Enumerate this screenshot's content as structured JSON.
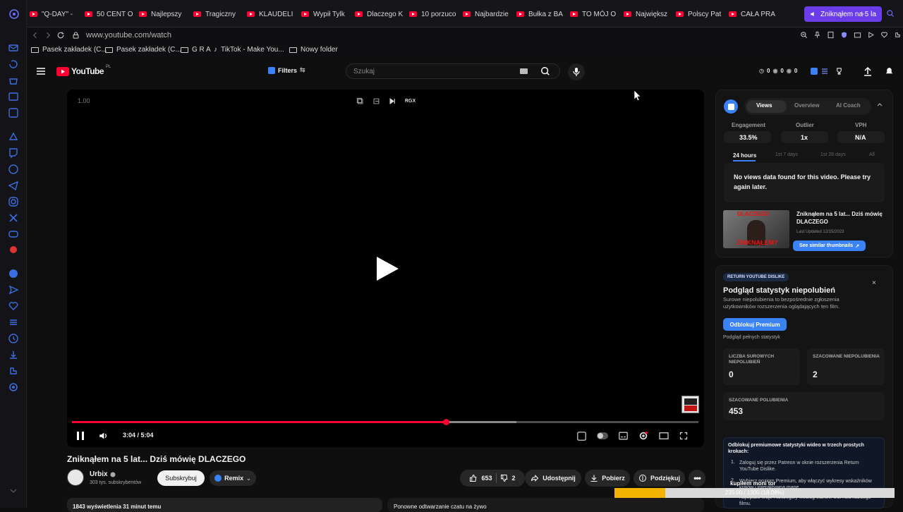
{
  "tabs": [
    {
      "label": "\"Q-DAY\" -"
    },
    {
      "label": "50 CENT O"
    },
    {
      "label": "Najlepszy"
    },
    {
      "label": "Tragiczny"
    },
    {
      "label": "KLAUDELI"
    },
    {
      "label": "Wypił Tylk"
    },
    {
      "label": "Dlaczego K"
    },
    {
      "label": "10 porzuco"
    },
    {
      "label": "Najbardzie"
    },
    {
      "label": "Bułka z BA"
    },
    {
      "label": "TO MÓJ O"
    },
    {
      "label": "Największ"
    },
    {
      "label": "Polscy Pat"
    },
    {
      "label": "CAŁA PRA"
    }
  ],
  "active_tab": {
    "label": "Zniknąłem na 5 la"
  },
  "url": "www.youtube.com/watch",
  "bookmarks": [
    {
      "label": "Pasek zakładek (C..."
    },
    {
      "label": "Pasek zakładek (C..."
    },
    {
      "label": "G R A"
    },
    {
      "label": "TikTok - Make You..."
    },
    {
      "label": "Nowy folder"
    }
  ],
  "yt": {
    "logo": "YouTube",
    "region": "PL",
    "filters": "Filters",
    "search_placeholder": "Szukaj",
    "header_counters": [
      "0",
      "0",
      "0"
    ]
  },
  "player": {
    "speed": "1.00",
    "rgx": "RGX",
    "time": "3:04 / 5:04",
    "progress": 0.597,
    "buffered": 0.71,
    "watermark": "Urbix PL"
  },
  "video": {
    "title": "Zniknąłem na 5 lat... Dziś mówię DLACZEGO",
    "channel": "Urbix",
    "subscribers": "303 tys. subskrybentów",
    "subscribe": "Subskrybuj",
    "remix": "Remix",
    "likes": "653",
    "dislikes": "2",
    "share": "Udostępnij",
    "download": "Pobierz",
    "thanks": "Podziękuj",
    "views_line": "1843 wyświetlenia  31 minut temu",
    "replay_line": "Ponowne odtwarzanie czatu na żywo"
  },
  "vidiq": {
    "tabs": [
      "Views",
      "Overview",
      "AI Coach"
    ],
    "metrics": [
      {
        "label": "Engagement",
        "value": "33.5%"
      },
      {
        "label": "Outlier",
        "value": "1x"
      },
      {
        "label": "VPH",
        "value": "N/A"
      }
    ],
    "ranges": [
      "24 hours",
      "1st 7 days",
      "1st 28 days",
      "All"
    ],
    "no_data": "No views data found for this video. Please try again later.",
    "thumb_title": "Zniknąłem na 5 lat... Dziś mówię DLACZEGO",
    "thumb_text_top": "DLACZEGO",
    "thumb_text_bottom": "ZNIKNĄŁEM?",
    "last_updated": "Last Updated 12/15/2023",
    "similar": "See similar thumbnails"
  },
  "rdy": {
    "badge": "RETURN YOUTUBE DISLIKE",
    "title": "Podgląd statystyk niepolubień",
    "desc": "Surowe niepolubienia to bezpośrednie zgłoszenia użytkowników rozszerzenia oglądających ten film.",
    "premium_btn": "Odblokuj Premium",
    "premium_note": "Podgląd pełnych statystyk",
    "raw_label": "LICZBA SUROWYCH NIEPOLUBIEŃ",
    "raw_value": "0",
    "est_label": "SZACOWANE NIEPOLUBIENIA",
    "est_value": "2",
    "likes_label": "SZACOWANE POLUBIENIA",
    "likes_value": "453",
    "unlock_title": "Odblokuj premiumowe statystyki wideo w trzech prostych krokach:",
    "step1": "Zaloguj się przez Patreon w oknie rozszerzenia Return YouTube Dislike.",
    "step2": "Wybierz poziom Premium, aby włączyć wykresy wskaźników krajów i interaktywną mapę.",
    "step3": "najlepsze kraje i szczegóły według stanów USA dla każdego filmu.",
    "overlay_a": "kupiłem moni tor",
    "overlay_b": "235.00 / 1300 (18.08%)",
    "overlay_progress": 0.1808
  },
  "colors": {
    "accent": "#ff0033",
    "vidiq": "#3b82f6",
    "tab_active": "#6a3de8"
  }
}
